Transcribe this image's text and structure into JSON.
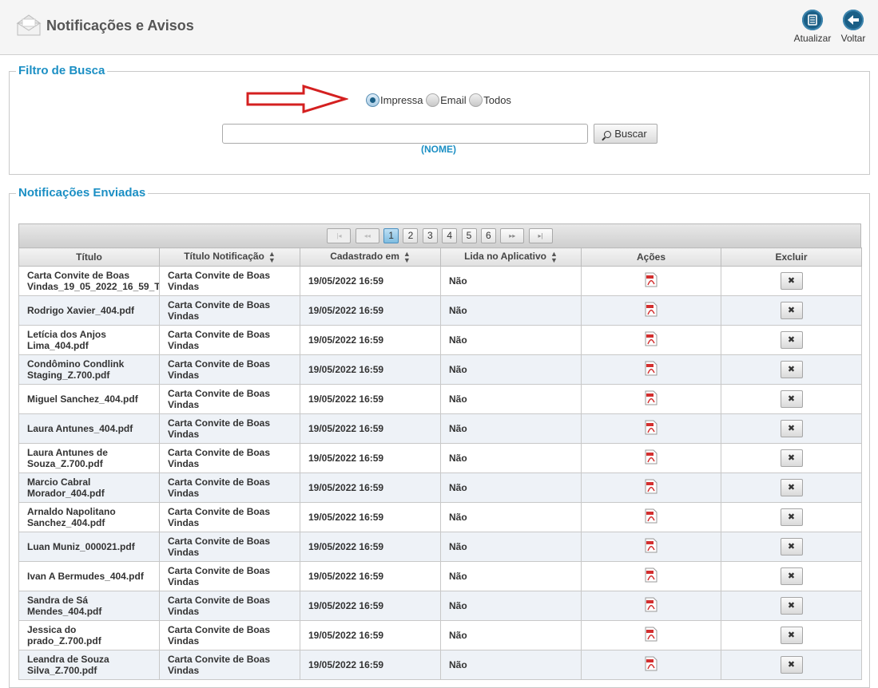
{
  "header": {
    "title": "Notificações e Avisos",
    "refresh_label": "Atualizar",
    "back_label": "Voltar"
  },
  "filter": {
    "legend": "Filtro de Busca",
    "radios": [
      {
        "label": "Impressa",
        "selected": true
      },
      {
        "label": "Email",
        "selected": false
      },
      {
        "label": "Todos",
        "selected": false
      }
    ],
    "search_value": "",
    "search_button": "Buscar",
    "hint": "(NOME)"
  },
  "sent": {
    "legend": "Notificações Enviadas",
    "pager": {
      "first": "|◂",
      "prev": "◂◂",
      "pages": [
        "1",
        "2",
        "3",
        "4",
        "5",
        "6"
      ],
      "current": "1",
      "next": "▸▸",
      "last": "▸|"
    },
    "columns": [
      "Título",
      "Título Notificação",
      "Cadastrado em",
      "Lida no Aplicativo",
      "Ações",
      "Excluir"
    ],
    "delete_glyph": "✖",
    "rows": [
      {
        "titulo": "Carta Convite de Boas Vindas_19_05_2022_16_59_T",
        "notificacao": "Carta Convite de Boas Vindas",
        "cadastrado": "19/05/2022 16:59",
        "lida": "Não"
      },
      {
        "titulo": "Rodrigo Xavier_404.pdf",
        "notificacao": "Carta Convite de Boas Vindas",
        "cadastrado": "19/05/2022 16:59",
        "lida": "Não"
      },
      {
        "titulo": "Letícia dos Anjos Lima_404.pdf",
        "notificacao": "Carta Convite de Boas Vindas",
        "cadastrado": "19/05/2022 16:59",
        "lida": "Não"
      },
      {
        "titulo": "Condômino Condlink Staging_Z.700.pdf",
        "notificacao": "Carta Convite de Boas Vindas",
        "cadastrado": "19/05/2022 16:59",
        "lida": "Não"
      },
      {
        "titulo": "Miguel Sanchez_404.pdf",
        "notificacao": "Carta Convite de Boas Vindas",
        "cadastrado": "19/05/2022 16:59",
        "lida": "Não"
      },
      {
        "titulo": "Laura Antunes_404.pdf",
        "notificacao": "Carta Convite de Boas Vindas",
        "cadastrado": "19/05/2022 16:59",
        "lida": "Não"
      },
      {
        "titulo": "Laura Antunes de Souza_Z.700.pdf",
        "notificacao": "Carta Convite de Boas Vindas",
        "cadastrado": "19/05/2022 16:59",
        "lida": "Não"
      },
      {
        "titulo": "Marcio Cabral Morador_404.pdf",
        "notificacao": "Carta Convite de Boas Vindas",
        "cadastrado": "19/05/2022 16:59",
        "lida": "Não"
      },
      {
        "titulo": "Arnaldo Napolitano Sanchez_404.pdf",
        "notificacao": "Carta Convite de Boas Vindas",
        "cadastrado": "19/05/2022 16:59",
        "lida": "Não"
      },
      {
        "titulo": "Luan Muniz_000021.pdf",
        "notificacao": "Carta Convite de Boas Vindas",
        "cadastrado": "19/05/2022 16:59",
        "lida": "Não"
      },
      {
        "titulo": "Ivan A Bermudes_404.pdf",
        "notificacao": "Carta Convite de Boas Vindas",
        "cadastrado": "19/05/2022 16:59",
        "lida": "Não"
      },
      {
        "titulo": "Sandra de Sá Mendes_404.pdf",
        "notificacao": "Carta Convite de Boas Vindas",
        "cadastrado": "19/05/2022 16:59",
        "lida": "Não"
      },
      {
        "titulo": "Jessica do prado_Z.700.pdf",
        "notificacao": "Carta Convite de Boas Vindas",
        "cadastrado": "19/05/2022 16:59",
        "lida": "Não"
      },
      {
        "titulo": "Leandra de Souza Silva_Z.700.pdf",
        "notificacao": "Carta Convite de Boas Vindas",
        "cadastrado": "19/05/2022 16:59",
        "lida": "Não"
      }
    ]
  },
  "colors": {
    "accent": "#1b8fc4",
    "icon_blue": "#1b5f86",
    "arrow_red": "#d42020",
    "pdf_red": "#d32f2f"
  }
}
